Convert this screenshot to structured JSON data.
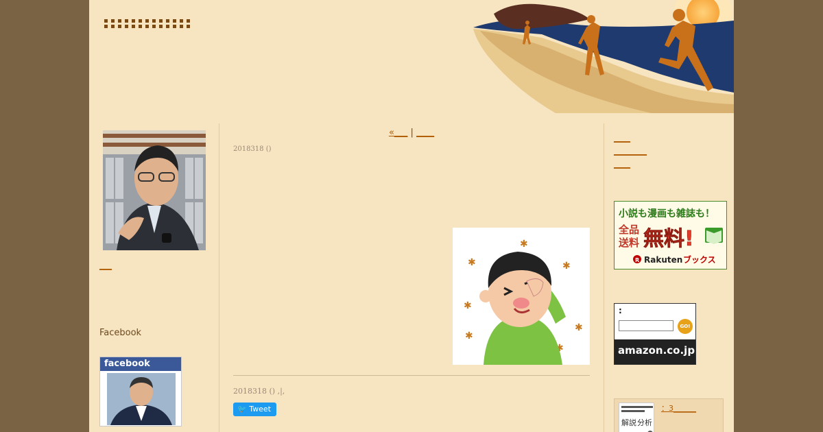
{
  "header": {
    "blog_title": "▪▪▪▪▪▪▪▪▪▪▪▪▪▪▪▪▪▪▪▪▪▪▪▪▪▪▪"
  },
  "left": {
    "link_label": "___",
    "facebook_heading": "Facebook",
    "fb_bar_label": "facebook"
  },
  "main": {
    "nav_prev": "«___",
    "nav_sep": " | ",
    "nav_next": "____",
    "post_date": "2018318 ()",
    "post_footer": "2018318 ()          ,|,",
    "tweet_label": "Tweet"
  },
  "right": {
    "links": [
      "____",
      "________",
      "____"
    ],
    "rakuten": {
      "line1": "小説も漫画も雑誌も！",
      "line2": "全品",
      "line3": "送料",
      "free": "無料!",
      "brand": "Rakuten",
      "brand_suffix": "ブックス"
    },
    "amazon": {
      "label": ":",
      "go": "GO!",
      "logo": "amazon.co.jp"
    },
    "book_link": "：3______",
    "book_title_line1": "解説",
    "book_title_line2": "分析"
  },
  "colors": {
    "outer_bg": "#7a6344",
    "page_bg": "#f7e4c0",
    "link": "#b05a00",
    "facebook": "#3b5998",
    "tweet": "#1d9bf0"
  }
}
